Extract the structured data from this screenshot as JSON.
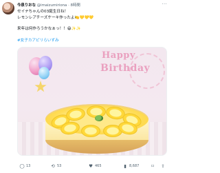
{
  "tweet": {
    "author": {
      "name": "今泉りおな",
      "handle": "@imaizumiriona",
      "separator": "·",
      "time": "8時間"
    },
    "text": {
      "line1": "セイナちゃんの03誕生日ね！",
      "line2": "レモンレアチーズケーキ作ったよ🍋💛💛💛",
      "line3": "来年は何作ろうかなぁっ！！😄✨✨",
      "hashtag": "#女子カアピリらいずみ"
    },
    "media": {
      "banner_line1": "Happy",
      "banner_line2": "Birthday"
    },
    "actions": {
      "reply_icon": "◯",
      "reply_count": "13",
      "retweet_icon": "⟲",
      "retweet_count": "53",
      "like_icon": "♥",
      "like_count": "465",
      "views_icon": "▮",
      "views_count": "8,687",
      "bookmark_icon": "⌑",
      "share_icon": "⇧"
    }
  }
}
